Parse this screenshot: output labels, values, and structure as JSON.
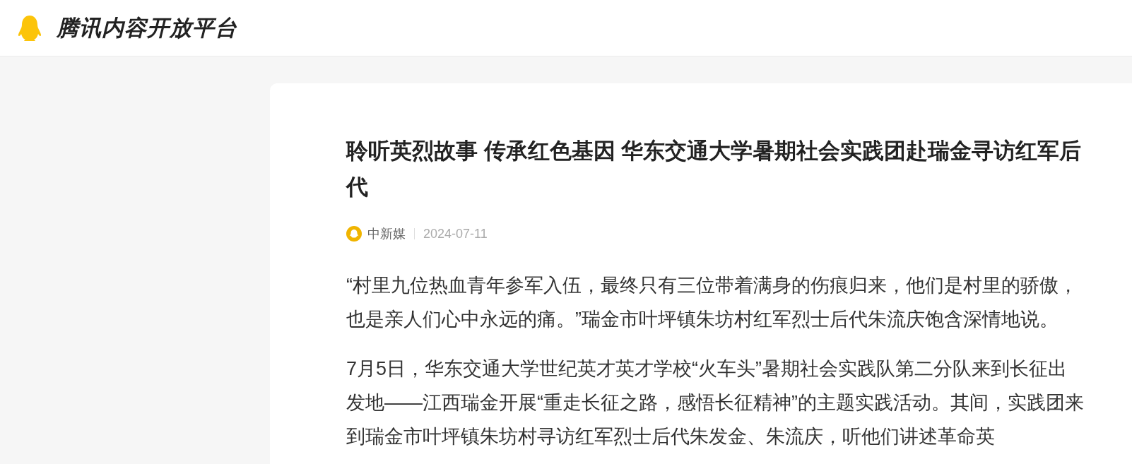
{
  "header": {
    "site_name": "腾讯内容开放平台"
  },
  "article": {
    "title": "聆听英烈故事 传承红色基因 华东交通大学暑期社会实践团赴瑞金寻访红军后代",
    "source": "中新媒",
    "date": "2024-07-11",
    "paragraphs": [
      "“村里九位热血青年参军入伍，最终只有三位带着满身的伤痕归来，他们是村里的骄傲，也是亲人们心中永远的痛。”瑞金市叶坪镇朱坊村红军烈士后代朱流庆饱含深情地说。",
      "7月5日，华东交通大学世纪英才英才学校“火车头”暑期社会实践队第二分队来到长征出发地——江西瑞金开展“重走长征之路，感悟长征精神”的主题实践活动。其间，实践团来到瑞金市叶坪镇朱坊村寻访红军烈士后代朱发金、朱流庆，听他们讲述革命英"
    ]
  }
}
